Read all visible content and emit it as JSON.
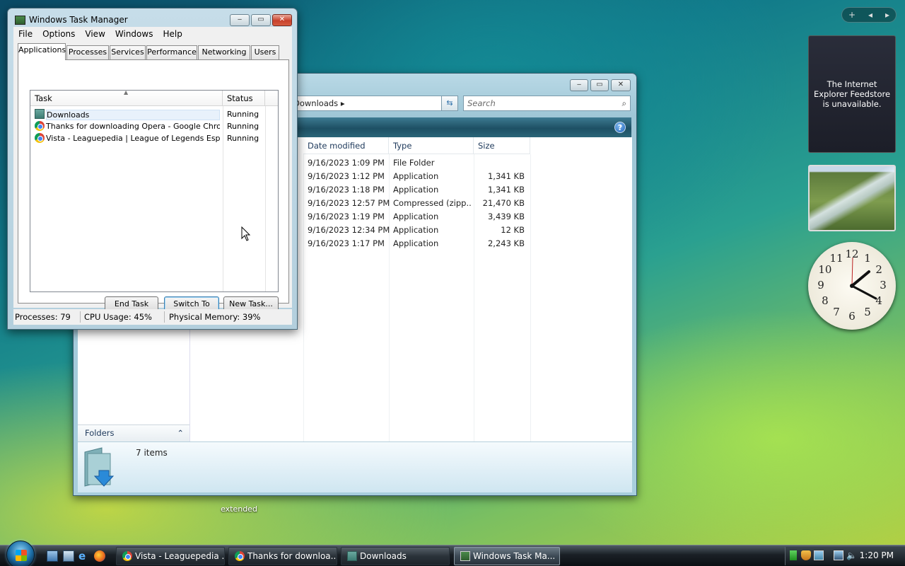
{
  "desktop": {
    "icon_label": "extended"
  },
  "sidebar": {
    "feed_message": "The Internet Explorer Feedstore is unavailable.",
    "clock": {
      "numbers": [
        "12",
        "1",
        "2",
        "3",
        "4",
        "5",
        "6",
        "7",
        "8",
        "9",
        "10",
        "11"
      ],
      "time": "1:20"
    }
  },
  "explorer": {
    "address": "Downloads",
    "search_placeholder": "Search",
    "columns": [
      "Date modified",
      "Type",
      "Size"
    ],
    "files": [
      {
        "date": "9/16/2023 1:09 PM",
        "type": "File Folder",
        "size": ""
      },
      {
        "date": "9/16/2023 1:12 PM",
        "type": "Application",
        "size": "1,341 KB"
      },
      {
        "date": "9/16/2023 1:18 PM",
        "type": "Application",
        "size": "1,341 KB"
      },
      {
        "date": "9/16/2023 12:57 PM",
        "type": "Compressed (zipp...",
        "size": "21,470 KB"
      },
      {
        "date": "9/16/2023 1:19 PM",
        "type": "Application",
        "size": "3,439 KB"
      },
      {
        "date": "9/16/2023 12:34 PM",
        "type": "Application",
        "size": "12 KB"
      },
      {
        "date": "9/16/2023 1:17 PM",
        "type": "Application",
        "size": "2,243 KB"
      }
    ],
    "folders_label": "Folders",
    "item_count": "7 items"
  },
  "taskmgr": {
    "title": "Windows Task Manager",
    "menu": [
      "File",
      "Options",
      "View",
      "Windows",
      "Help"
    ],
    "tabs": [
      "Applications",
      "Processes",
      "Services",
      "Performance",
      "Networking",
      "Users"
    ],
    "list_headers": {
      "task": "Task",
      "status": "Status"
    },
    "tasks": [
      {
        "name": "Downloads",
        "status": "Running",
        "icon": "folder-icon"
      },
      {
        "name": "Thanks for downloading Opera - Google Chrome",
        "status": "Running",
        "icon": "chrome-icon"
      },
      {
        "name": "Vista - Leaguepedia | League of Legends Esports Wiki - Google Chrome",
        "status": "Running",
        "icon": "chrome-icon"
      }
    ],
    "buttons": {
      "end_task": "End Task",
      "switch_to": "Switch To",
      "new_task": "New Task..."
    },
    "status": {
      "processes": "Processes: 79",
      "cpu": "CPU Usage: 45%",
      "memory": "Physical Memory: 39%"
    }
  },
  "taskbar": {
    "buttons": [
      "Vista - Leaguepedia ...",
      "Thanks for downloa...",
      "Downloads",
      "Windows Task Ma..."
    ],
    "time": "1:20 PM"
  },
  "colors": {
    "accent": "#1e5064",
    "taskbar": "#1a2026",
    "close": "#c8412c"
  }
}
